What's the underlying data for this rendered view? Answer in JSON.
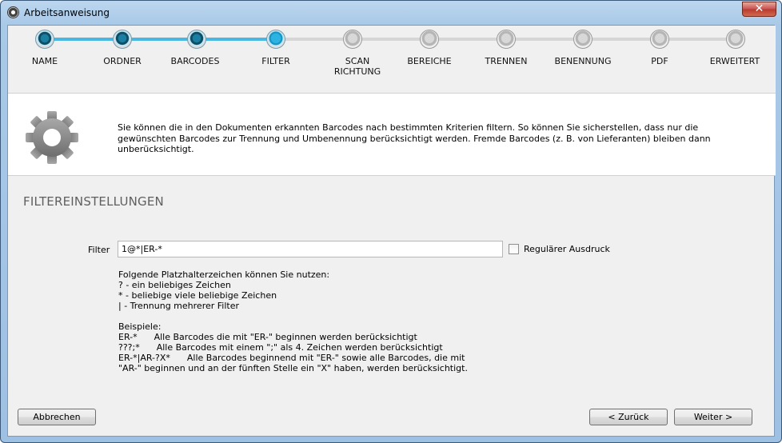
{
  "window": {
    "title": "Arbeitsanweisung",
    "close_glyph": "✕"
  },
  "stepper": {
    "steps": [
      {
        "label": "NAME",
        "state": "done"
      },
      {
        "label": "ORDNER",
        "state": "done"
      },
      {
        "label": "BARCODES",
        "state": "done"
      },
      {
        "label": "FILTER",
        "state": "current"
      },
      {
        "label": "SCAN\nRICHTUNG",
        "state": "todo"
      },
      {
        "label": "BEREICHE",
        "state": "todo"
      },
      {
        "label": "TRENNEN",
        "state": "todo"
      },
      {
        "label": "BENENNUNG",
        "state": "todo"
      },
      {
        "label": "PDF",
        "state": "todo"
      },
      {
        "label": "ERWEITERT",
        "state": "todo"
      }
    ],
    "colors": {
      "done_line": "#48b8e2",
      "todo_line": "#d6d6d6"
    }
  },
  "info": {
    "icon": "gear-icon",
    "text": "Sie können die in den Dokumenten erkannten Barcodes nach bestimmten Kriterien filtern. So können Sie sicherstellen, dass nur die gewünschten Barcodes zur Trennung und Umbenennung berücksichtigt werden. Fremde Barcodes (z. B. von Lieferanten) bleiben dann unberücksichtigt."
  },
  "section": {
    "title": "FILTEREINSTELLUNGEN"
  },
  "filter": {
    "label": "Filter",
    "value": "1@*|ER-*",
    "regex_label": "Regulärer Ausdruck",
    "regex_checked": false
  },
  "hints": {
    "intro": "Folgende Platzhalterzeichen können Sie nutzen:",
    "items": [
      "? - ein beliebiges Zeichen",
      "* - beliebige viele beliebige Zeichen",
      "| - Trennung mehrerer Filter"
    ],
    "examples_title": "Beispiele:",
    "examples": [
      "ER-*      Alle Barcodes die mit \"ER-\" beginnen werden berücksichtigt",
      "???;*      Alle Barcodes mit einem \";\" als 4. Zeichen werden berücksichtigt",
      "ER-*|AR-?X*      Alle Barcodes beginnend mit \"ER-\" sowie alle Barcodes, die mit",
      "\"AR-\" beginnen und an der fünften Stelle ein \"X\" haben, werden berücksichtigt."
    ]
  },
  "buttons": {
    "cancel": "Abbrechen",
    "back": "< Zurück",
    "next": "Weiter >"
  }
}
